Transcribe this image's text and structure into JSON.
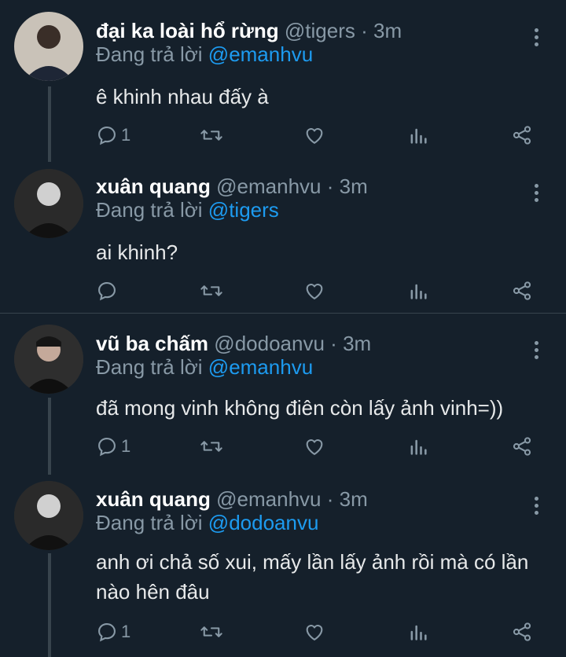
{
  "colors": {
    "background": "#15202b",
    "accent": "#1d9bf0",
    "muted": "#8899a6",
    "divider": "#38444d"
  },
  "tweets": [
    {
      "name": "đại ka loài hổ rừng",
      "handle": "@tigers",
      "dot": "·",
      "time": "3m",
      "replying_label": "Đang trả lời",
      "replying_to": "@emanhvu",
      "text": "ê khinh nhau đấy à",
      "reply_count": "1",
      "avatar_icon": "avatar-person-icon"
    },
    {
      "name": "xuân quang",
      "handle": "@emanhvu",
      "dot": "·",
      "time": "3m",
      "replying_label": "Đang trả lời",
      "replying_to": "@tigers",
      "text": "ai khinh?",
      "reply_count": "",
      "avatar_icon": "avatar-person-icon"
    },
    {
      "name": "vũ ba chấm",
      "handle": "@dodoanvu",
      "dot": "·",
      "time": "3m",
      "replying_label": "Đang trả lời",
      "replying_to": "@emanhvu",
      "text": "đã mong vinh không điên còn lấy ảnh vinh=))",
      "reply_count": "1",
      "avatar_icon": "avatar-person-icon"
    },
    {
      "name": "xuân quang",
      "handle": "@emanhvu",
      "dot": "·",
      "time": "3m",
      "replying_label": "Đang trả lời",
      "replying_to": "@dodoanvu",
      "text": "anh ơi chả số xui, mấy lần lấy ảnh rồi mà có lần nào hên đâu",
      "reply_count": "1",
      "avatar_icon": "avatar-person-icon"
    }
  ]
}
